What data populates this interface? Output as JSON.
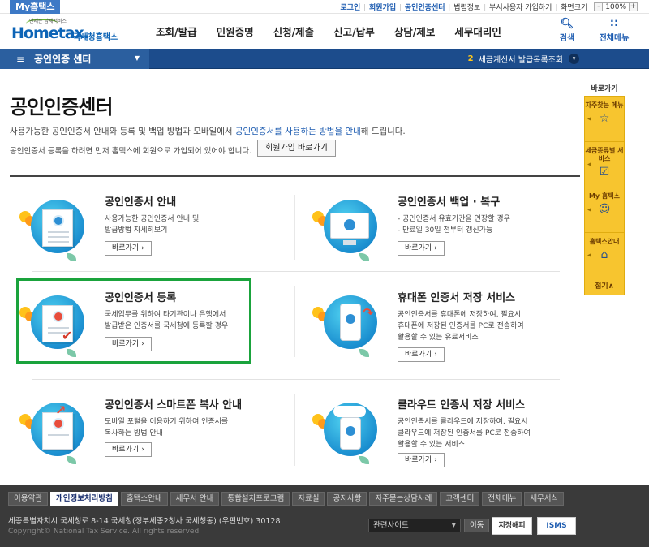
{
  "topbar": {
    "my_tab": "My홈택스",
    "links": [
      "로그인",
      "회원가입",
      "공인인증센터",
      "법령정보",
      "부서사용자 가입하기",
      "화면크기"
    ],
    "zoom_minus": "-",
    "zoom_value": "100%",
    "zoom_plus": "+"
  },
  "header": {
    "logo_word": "Hometax.",
    "logo_sub": "언제든 납세서비스",
    "logo_kr": "국세청홈택스",
    "menus": [
      "조회/발급",
      "민원증명",
      "신청/제출",
      "신고/납부",
      "상담/제보",
      "세무대리인"
    ],
    "search_label": "검색",
    "allmenu_label": "전체메뉴"
  },
  "locbar": {
    "title": "공인인증 센터",
    "rolling_num": "2",
    "rolling_text": "세금계산서 발급목록조회"
  },
  "quick": {
    "title": "바로가기",
    "items": [
      "자주찾는 메뉴",
      "세금종류별 서비스",
      "My 홈택스",
      "홈택스안내"
    ],
    "fold": "접기∧"
  },
  "content": {
    "title": "공인인증센터",
    "desc_pre": "사용가능한 공인인증서 안내와 등록 및 백업 방법과 모바일에서 ",
    "desc_hl": "공인인증서를 사용하는 방법을 안내",
    "desc_post": "해 드립니다.",
    "note": "공인인증서 등록을 하려면 먼저 홈택스에 회원으로 가입되어 있어야 합니다.",
    "join_btn": "회원가입 바로가기"
  },
  "cards": [
    {
      "title": "공인인증서 안내",
      "lines": [
        "사용가능한 공인인증서 안내 및",
        "발급방법 자세히보기"
      ],
      "go": "바로가기"
    },
    {
      "title": "공인인증서 백업 · 복구",
      "lines": [
        "- 공인인증서 유효기간을 연장할 경우",
        "- 만료일 30일 전부터 갱신가능"
      ],
      "go": "바로가기"
    },
    {
      "title": "공인인증서 등록",
      "lines": [
        "국세업무를 위하여 타기관이나 은행에서",
        "발급받은 인증서를 국세청에 등록할 경우"
      ],
      "go": "바로가기"
    },
    {
      "title": "휴대폰 인증서 저장 서비스",
      "lines": [
        "공인인증서를 휴대폰에 저장하여, 필요시",
        "휴대폰에 저장된 인증서를 PC로 전송하여",
        "활용할 수 있는 유료서비스"
      ],
      "go": "바로가기"
    },
    {
      "title": "공인인증서 스마트폰 복사 안내",
      "lines": [
        "모바일 포털을 이용하기 위하여 인증서를",
        "복사하는 방법 안내"
      ],
      "go": "바로가기"
    },
    {
      "title": "클라우드 인증서 저장 서비스",
      "lines": [
        "공인인증서를 클라우드에 저장하여, 필요시",
        "클라우드에 저장된 인증서를 PC로 전송하여",
        "활용할 수 있는 서비스"
      ],
      "go": "바로가기"
    }
  ],
  "footer": {
    "nav": [
      "이용약관",
      "개인정보처리방침",
      "홈택스안내",
      "세무서 안내",
      "통합설치프로그램",
      "자료실",
      "공지사항",
      "자주묻는상담사례",
      "고객센터",
      "전체메뉴",
      "세무서식"
    ],
    "address": "세종특별자치시 국세청로 8-14 국세청(정부세종2청사 국세청동) (우편번호) 30128",
    "copyright": "Copyright© National Tax Service. All rights reserved.",
    "related_site": "관련사이트",
    "go": "이동",
    "badge1": "지정해피",
    "badge2": "ISMS"
  }
}
